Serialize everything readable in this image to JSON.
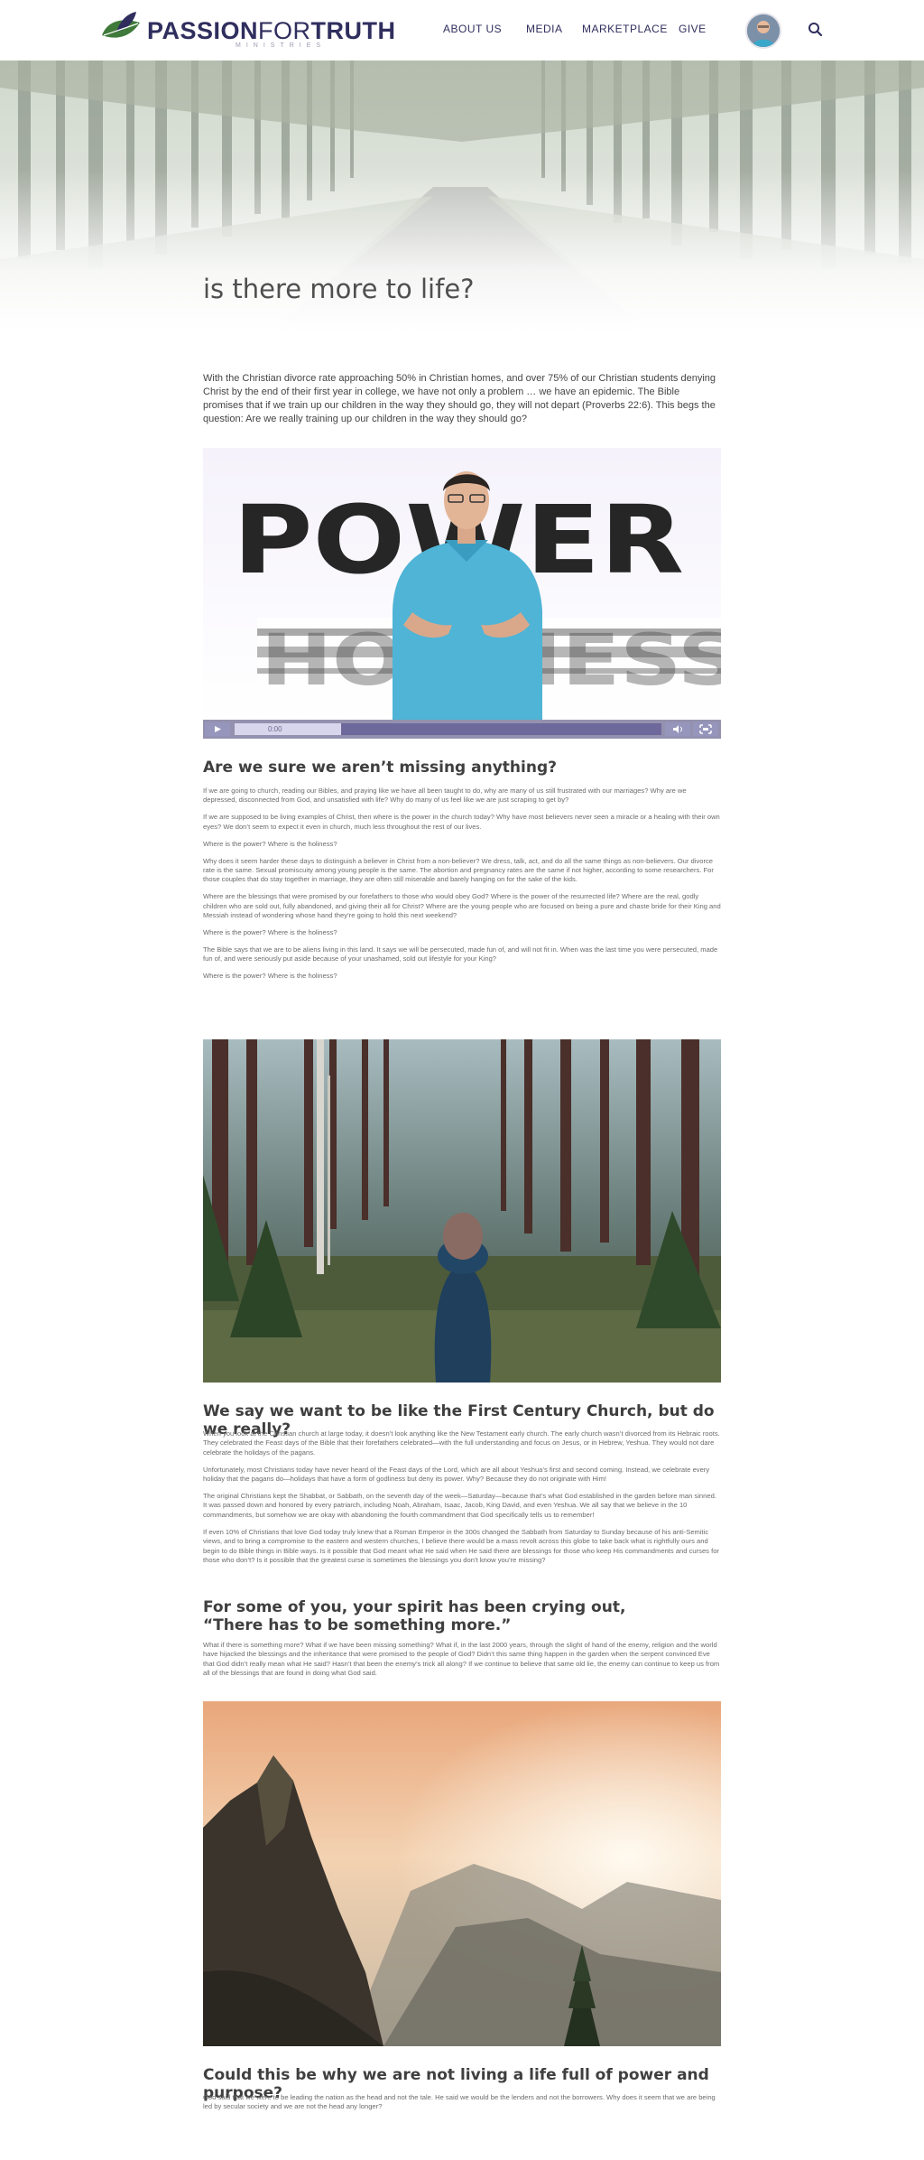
{
  "brand": {
    "name_bold_1": "PASSION",
    "name_light": "FOR",
    "name_bold_2": "TRUTH",
    "sub": "MINISTRIES"
  },
  "nav": {
    "items": [
      "ABOUT US",
      "MEDIA",
      "MARKETPLACE",
      "GIVE"
    ]
  },
  "page": {
    "title": "is there more to life?"
  },
  "intro": "With the Christian divorce rate approaching 50% in Christian homes, and over 75% of our Christian students denying Christ by the end of their first year in college, we have not only a problem … we have an epidemic. The Bible promises that if we train up our children in the way they should go, they will not depart (Proverbs 22:6). This begs the question: Are we really training up our children in the way they should go?",
  "video": {
    "word_top": "POWER",
    "word_bottom": "HOLINESS",
    "time": "0:00",
    "progress": 0.25,
    "buffer": 0.25
  },
  "section1": {
    "heading": "Are we sure we aren’t missing anything?",
    "paragraphs": [
      "If we are going to church, reading our Bibles, and praying like we have all been taught to do, why are many of us still frustrated with our marriages? Why are we depressed, disconnected from God, and unsatisfied with life? Why do many of us feel like we are just scraping to get by?",
      "If we are supposed to be living examples of Christ, then where is the power in the church today? Why have most believers never seen a miracle or a healing with their own eyes? We don’t seem to expect it even in church, much less throughout the rest of our lives.",
      "Where is the power? Where is the holiness?",
      "Why does it seem harder these days to distinguish a believer in Christ from a non-believer? We dress, talk, act, and do all the same things as non-believers. Our divorce rate is the same. Sexual promiscuity among young people is the same. The abortion and pregnancy rates are the same if not higher, according to some researchers. For those couples that do stay together in marriage, they are often still miserable and barely hanging on for the sake of the kids.",
      "Where are the blessings that were promised by our forefathers to those who would obey God? Where is the power of the resurrected life? Where are the real, godly children who are sold out, fully abandoned, and giving their all for Christ? Where are the young people who are focused on being a pure and chaste bride for their King and Messiah instead of wondering whose hand they’re going to hold this next weekend?",
      "Where is the power? Where is the holiness?",
      "The Bible says that we are to be aliens living in this land. It says we will be persecuted, made fun of, and will not fit in. When was the last time you were persecuted, made fun of, and were seriously put aside because of your unashamed, sold out lifestyle for your King?",
      "Where is the power? Where is the holiness?"
    ]
  },
  "section2": {
    "heading": "We say we want to be like the First Century Church, but do we really?",
    "paragraphs": [
      "When you look at the Christian church at large today, it doesn’t look anything like the New Testament early church. The early church wasn’t divorced from its Hebraic roots. They celebrated the Feast days of the Bible that their forefathers celebrated—with the full understanding and focus on Jesus, or in Hebrew, Yeshua. They would not dare celebrate the holidays of the pagans.",
      "Unfortunately, most Christians today have never heard of the Feast days of the Lord, which are all about Yeshua’s first and second coming. Instead, we celebrate every holiday that the pagans do—holidays that have a form of godliness but deny its power. Why? Because they do not originate with Him!",
      "The original Christians kept the Shabbat, or Sabbath, on the seventh day of the week—Saturday—because that’s what God established in the garden before man sinned. It was passed down and honored by every patriarch, including Noah, Abraham, Isaac, Jacob, King David, and even Yeshua. We all say that we believe in the 10 commandments, but somehow we are okay with abandoning the fourth commandment that God specifically tells us to remember!",
      "If even 10% of Christians that love God today truly knew that a Roman Emperor in the 300s changed the Sabbath from Saturday to Sunday because of his anti-Semitic views, and to bring a compromise to the eastern and western churches, I believe there would be a mass revolt across this globe to take back what is rightfully ours and begin to do Bible things in Bible ways. Is it possible that God meant what He said when He said there are blessings for those who keep His commandments and curses for those who don’t? Is it possible that the greatest curse is sometimes the blessings you don’t know you’re missing?"
    ]
  },
  "section3": {
    "heading_line1": "For some of you, your spirit has been crying out,",
    "heading_line2": "“There has to be something more.”",
    "paragraphs": [
      "What if there is something more? What if we have been missing something? What if, in the last 2000 years, through the slight of hand of the enemy, religion and the world have hijacked the blessings and the inheritance that were promised to the people of God? Didn’t this same thing happen in the garden when the serpent convinced Eve that God didn’t really mean what He said? Hasn’t that been the enemy’s trick all along? If we continue to believe that same old lie, the enemy can continue to keep us from all of the blessings that are found in doing what God said."
    ]
  },
  "section4": {
    "heading": "Could this be why we are not living a life full of power and purpose?",
    "paragraphs": [
      "God said that we were to be leading the nation as the head and not the tale. He said we would be the lenders and not the borrowers. Why does it seem that we are being led by secular society and we are not the head any longer?"
    ]
  },
  "colors": {
    "brand": "#2f2e5e",
    "leaf": "#3f7a3a",
    "accent_purple": "#4a3f7f"
  }
}
